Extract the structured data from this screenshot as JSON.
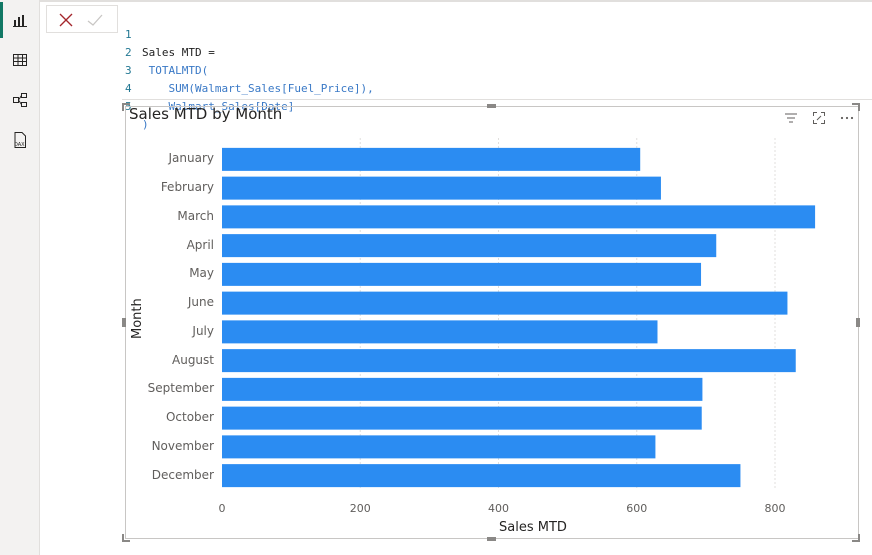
{
  "formula": {
    "lines": [
      {
        "num": "1",
        "text": "Sales MTD ="
      },
      {
        "num": "2",
        "text": " TOTALMTD("
      },
      {
        "num": "3",
        "text": "    SUM(Walmart_Sales[Fuel_Price]),"
      },
      {
        "num": "4",
        "text": "    Walmart_Sales[Date]"
      },
      {
        "num": "5",
        "text": ")"
      }
    ]
  },
  "visual": {
    "title": "Sales MTD by Month"
  },
  "chart_data": {
    "type": "bar",
    "orientation": "horizontal",
    "title": "Sales MTD by Month",
    "xlabel": "Sales MTD",
    "ylabel": "Month",
    "categories": [
      "January",
      "February",
      "March",
      "April",
      "May",
      "June",
      "July",
      "August",
      "September",
      "October",
      "November",
      "December"
    ],
    "values": [
      605,
      635,
      858,
      715,
      693,
      818,
      630,
      830,
      695,
      694,
      627,
      750
    ],
    "xlim": [
      0,
      860
    ],
    "xticks": [
      "0",
      "200",
      "400",
      "600",
      "800"
    ],
    "grid": true,
    "bar_color": "#2b8cf2"
  }
}
